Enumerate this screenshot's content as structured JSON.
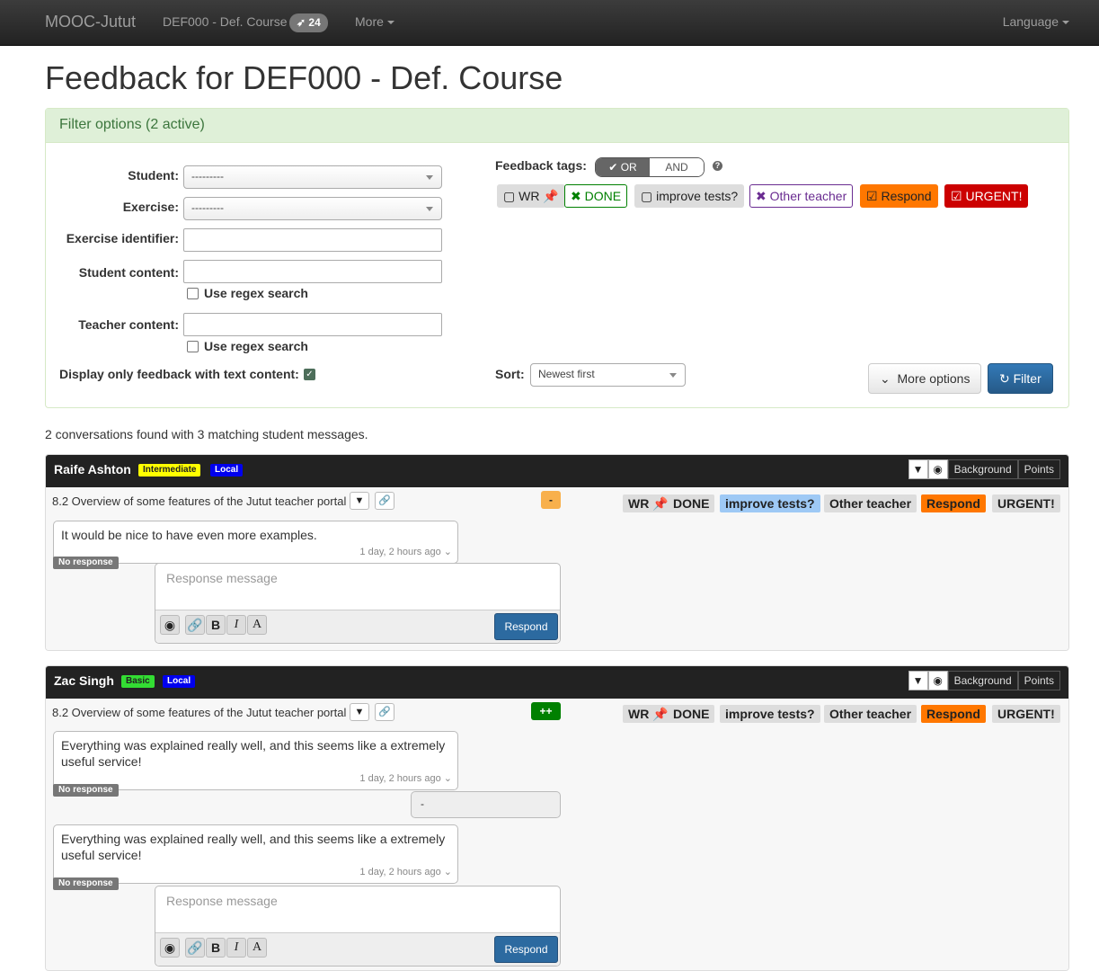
{
  "navbar": {
    "brand": "MOOC-Jutut",
    "course": "DEF000 - Def. Course",
    "badge": "24",
    "more": "More",
    "language": "Language"
  },
  "page_title": "Feedback for DEF000 - Def. Course",
  "filter": {
    "heading": "Filter options (2 active)",
    "student_label": "Student:",
    "student_value": "---------",
    "exercise_label": "Exercise:",
    "exercise_value": "---------",
    "exercise_id_label": "Exercise identifier:",
    "student_content_label": "Student content:",
    "regex_label": "Use regex search",
    "teacher_content_label": "Teacher content:",
    "display_only_label": "Display only feedback with text content:",
    "tags_label": "Feedback tags:",
    "or_label": "OR",
    "and_label": "AND",
    "tags": [
      {
        "label": "WR",
        "color": "#dddddd"
      },
      {
        "label": "DONE",
        "color": "#008000"
      },
      {
        "label": "improve tests?",
        "color": "#dddddd"
      },
      {
        "label": "Other teacher",
        "color": "#6a2c91"
      },
      {
        "label": "Respond",
        "color": "#ff7700"
      },
      {
        "label": "URGENT!",
        "color": "#cc0000"
      }
    ],
    "sort_label": "Sort:",
    "sort_value": "Newest first",
    "more_options": "More options",
    "filter_button": "Filter"
  },
  "summary": "2 conversations found with 3 matching student messages.",
  "header_buttons": {
    "background": "Background",
    "points": "Points"
  },
  "conversations": [
    {
      "student": "Raife Ashton",
      "level": "Intermediate",
      "level_color": "#ffff00",
      "scope": "Local",
      "exercise": "8.2 Overview of some features of the Jutut teacher portal",
      "grade": "-",
      "grade_color": "#f8b04c",
      "tags": [
        "WR",
        "DONE",
        "improve tests?",
        "Other teacher",
        "Respond",
        "URGENT!"
      ],
      "messages": [
        {
          "text": "It would be nice to have even more examples.",
          "time": "1 day, 2 hours ago",
          "status": "No response"
        }
      ],
      "reply_placeholder": "Response message",
      "respond_label": "Respond"
    },
    {
      "student": "Zac Singh",
      "level": "Basic",
      "level_color": "#33dd33",
      "scope": "Local",
      "exercise": "8.2 Overview of some features of the Jutut teacher portal",
      "grade": "++",
      "grade_color": "#008000",
      "tags": [
        "WR",
        "DONE",
        "improve tests?",
        "Other teacher",
        "Respond",
        "URGENT!"
      ],
      "messages": [
        {
          "text": "Everything was explained really well, and this seems like a extremely useful service!",
          "time": "1 day, 2 hours ago",
          "status": "No response"
        },
        {
          "text": "Everything was explained really well, and this seems like a extremely useful service!",
          "time": "1 day, 2 hours ago",
          "status": "No response"
        }
      ],
      "teacher_note": "-",
      "reply_placeholder": "Response message",
      "respond_label": "Respond"
    }
  ]
}
